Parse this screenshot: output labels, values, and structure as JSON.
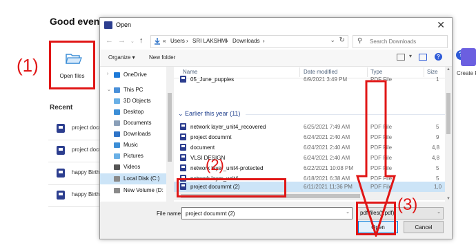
{
  "app": {
    "greeting": "Good eveni",
    "open_files_label": "Open files",
    "recent_label": "Recent",
    "recent_items": [
      {
        "name": "project docu"
      },
      {
        "name": "project docu"
      },
      {
        "name": "happy Birth"
      },
      {
        "name": "happy Birth"
      }
    ],
    "create_label": "Create P",
    "help_icon": "?"
  },
  "annotations": {
    "step1": "(1)",
    "step2": "(2)",
    "step3": "(3)",
    "color": "#e01616"
  },
  "dialog": {
    "title": "Open",
    "close_glyph": "✕",
    "breadcrumb": [
      "«",
      "Users",
      "›",
      "SRI LAKSHMI",
      "›",
      "Downloads",
      "›"
    ],
    "search_placeholder": "Search Downloads",
    "toolbar": {
      "organize": "Organize ▾",
      "new_folder": "New folder"
    },
    "nav_items": [
      {
        "label": "OneDrive",
        "icon": "cloud-icon",
        "color": "#1e7ad8",
        "arrow": "›"
      },
      {
        "label": "This PC",
        "icon": "computer-icon",
        "color": "#4a90d9",
        "arrow": "⌄"
      },
      {
        "label": "3D Objects",
        "icon": "cube-icon",
        "color": "#6ab0e6"
      },
      {
        "label": "Desktop",
        "icon": "desktop-icon",
        "color": "#3c8ed6"
      },
      {
        "label": "Documents",
        "icon": "documents-icon",
        "color": "#8a9fb8"
      },
      {
        "label": "Downloads",
        "icon": "download-icon",
        "color": "#2f74c8"
      },
      {
        "label": "Music",
        "icon": "music-icon",
        "color": "#3c8ed6"
      },
      {
        "label": "Pictures",
        "icon": "pictures-icon",
        "color": "#6ab0e6"
      },
      {
        "label": "Videos",
        "icon": "videos-icon",
        "color": "#555555"
      },
      {
        "label": "Local Disk (C:)",
        "icon": "disk-icon",
        "color": "#8a8a8a",
        "selected": true
      },
      {
        "label": "New Volume (D:",
        "icon": "volume-icon",
        "color": "#8a8a8a"
      }
    ],
    "columns": {
      "name": "Name",
      "date": "Date modified",
      "type": "Type",
      "size": "Size"
    },
    "partial_row": {
      "name": "05_June_puppies",
      "date": "6/9/2021 3:49 PM",
      "type": "PDF File",
      "size": "1"
    },
    "group_header": "Earlier this year (11)",
    "files": [
      {
        "name": "network layer_unit4_recovered",
        "date": "6/25/2021 7:49 AM",
        "type": "PDF File",
        "size": "5"
      },
      {
        "name": "project documrnt",
        "date": "6/24/2021 2:40 AM",
        "type": "PDF File",
        "size": "9"
      },
      {
        "name": "document",
        "date": "6/24/2021 2:40 AM",
        "type": "PDF File",
        "size": "4,8"
      },
      {
        "name": "VLSI DESIGN",
        "date": "6/24/2021 2:40 AM",
        "type": "PDF File",
        "size": "4,8"
      },
      {
        "name": "network layer_unit4-protected",
        "date": "6/22/2021 10:08 PM",
        "type": "PDF File",
        "size": "5"
      },
      {
        "name": "network layer_unit4",
        "date": "6/18/2021 6:38 AM",
        "type": "PDF File",
        "size": "5"
      },
      {
        "name": "project documrnt (2)",
        "date": "6/11/2021 11:36 PM",
        "type": "PDF File",
        "size": "1,0",
        "selected": true
      }
    ],
    "file_name_label": "File name:",
    "file_name_value": "project documrnt (2)",
    "file_type_value": "pdf files(*.pdf)",
    "open_button": "Open",
    "cancel_button": "Cancel"
  }
}
